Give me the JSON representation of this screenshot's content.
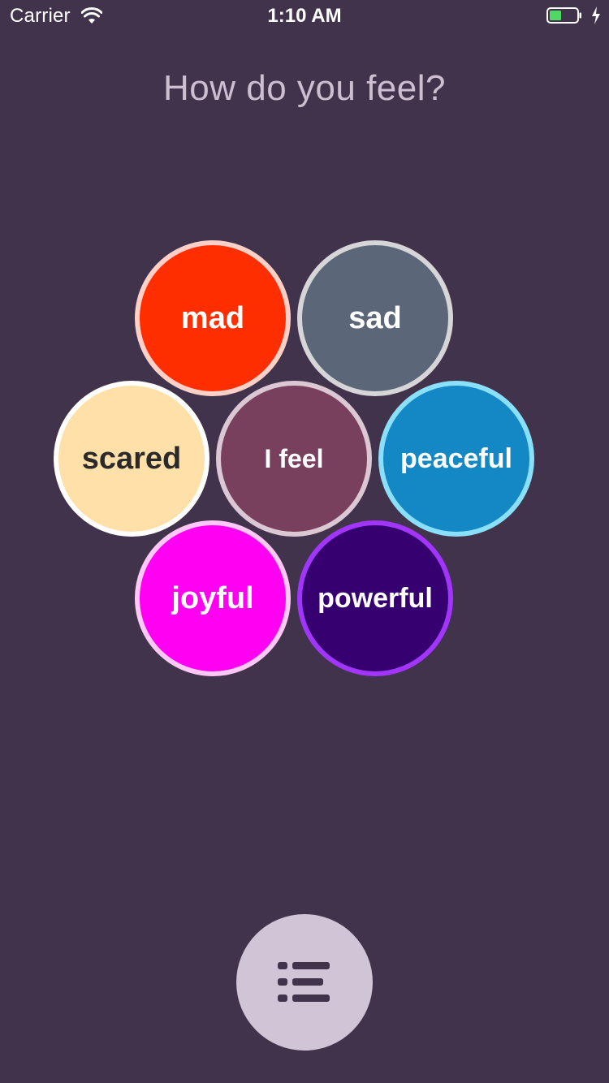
{
  "status_bar": {
    "carrier": "Carrier",
    "time": "1:10 AM",
    "battery_color": "#4cd964"
  },
  "title": "How do you feel?",
  "emotions": [
    {
      "label": "mad",
      "fill": "#ff2e00",
      "border": "#ffd0c8",
      "text_color": "#ffffff"
    },
    {
      "label": "sad",
      "fill": "#5b6678",
      "border": "#d6d6d8",
      "text_color": "#ffffff"
    },
    {
      "label": "scared",
      "fill": "#ffe0a8",
      "border": "#ffffff",
      "text_color": "#2a2a2a"
    },
    {
      "label": "I feel",
      "fill": "#79405e",
      "border": "#dbc8d4",
      "text_color": "#ffffff"
    },
    {
      "label": "peaceful",
      "fill": "#1388c4",
      "border": "#8ae0fb",
      "text_color": "#ffffff"
    },
    {
      "label": "joyful",
      "fill": "#ff00f2",
      "border": "#ffc8f6",
      "text_color": "#ffffff"
    },
    {
      "label": "powerful",
      "fill": "#370070",
      "border": "#a235fb",
      "text_color": "#ffffff"
    }
  ],
  "menu_button": {
    "icon": "list-icon",
    "fill": "#d0c5d6",
    "icon_color": "#42334c"
  },
  "background": "#42334c"
}
